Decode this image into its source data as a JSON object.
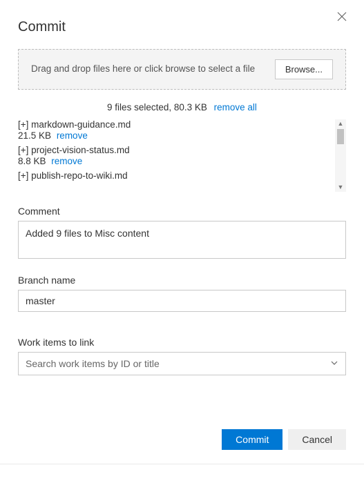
{
  "dialog": {
    "title": "Commit"
  },
  "dropzone": {
    "text": "Drag and drop files here or click browse to select a file",
    "browse_label": "Browse..."
  },
  "selected": {
    "summary": "9 files selected, 80.3 KB",
    "remove_all_label": "remove all"
  },
  "files": [
    {
      "name": "[+] markdown-guidance.md",
      "size": "21.5 KB",
      "remove_label": "remove"
    },
    {
      "name": "[+] project-vision-status.md",
      "size": "8.8 KB",
      "remove_label": "remove"
    },
    {
      "name": "[+] publish-repo-to-wiki.md",
      "size": "",
      "remove_label": ""
    }
  ],
  "comment": {
    "label": "Comment",
    "value": "Added 9 files to Misc content"
  },
  "branch": {
    "label": "Branch name",
    "value": "master"
  },
  "work_items": {
    "label": "Work items to link",
    "placeholder": "Search work items by ID or title"
  },
  "actions": {
    "commit_label": "Commit",
    "cancel_label": "Cancel"
  }
}
